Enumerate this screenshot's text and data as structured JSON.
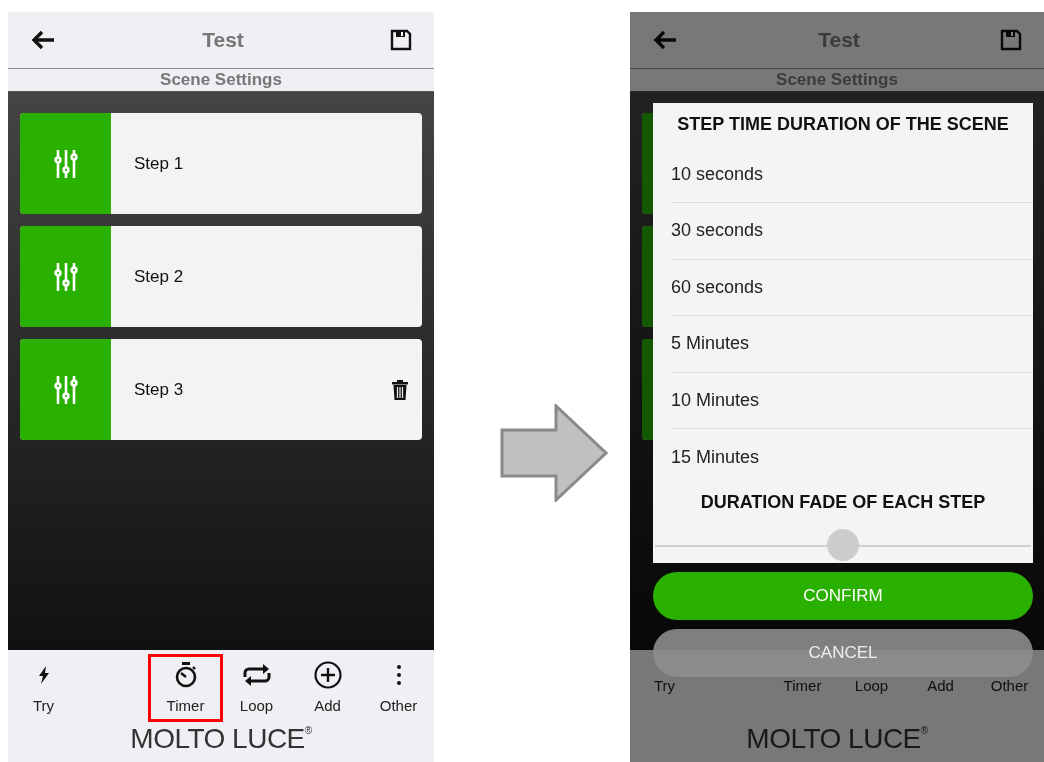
{
  "screens": [
    {
      "header": {
        "title": "Test"
      },
      "subtitle": "Scene Settings",
      "steps": [
        {
          "label": "Step 1",
          "deletable": false
        },
        {
          "label": "Step 2",
          "deletable": false
        },
        {
          "label": "Step 3",
          "deletable": true
        }
      ],
      "tab_bar": [
        {
          "label": "Try",
          "highlighted": false,
          "icon_visible": true
        },
        {
          "label": "Timer",
          "highlighted": true,
          "icon_visible": true
        },
        {
          "label": "Loop",
          "highlighted": false,
          "icon_visible": true
        },
        {
          "label": "Add",
          "highlighted": false,
          "icon_visible": true
        },
        {
          "label": "Other",
          "highlighted": false,
          "icon_visible": true
        }
      ],
      "logo": "MOLTO LUCE$^{®}$"
    },
    {
      "header": {
        "title": "Test"
      },
      "subtitle": "Scene Settings",
      "tab_bar": [
        {
          "label": "Try",
          "highlighted": false,
          "icon_visible": false
        },
        {
          "label": "Timer",
          "highlighted": false,
          "icon_visible": false
        },
        {
          "label": "Loop",
          "highlighted": false,
          "icon_visible": false
        },
        {
          "label": "Add",
          "highlighted": false,
          "icon_visible": false
        },
        {
          "label": "Other",
          "highlighted": false,
          "icon_visible": false
        }
      ],
      "logo": "MOLTO LUCE$^{®}$",
      "dialog": {
        "title": "STEP TIME DURATION OF THE SCENE",
        "options": [
          "10 seconds",
          "30 seconds",
          "60 seconds",
          "5 Minutes",
          "10 Minutes",
          "15 Minutes"
        ],
        "fade_title": "DURATION FADE OF EACH STEP",
        "fade_slider": {
          "level": 0.5
        },
        "confirm": "CONFIRM",
        "cancel": "CANCEL"
      }
    }
  ]
}
